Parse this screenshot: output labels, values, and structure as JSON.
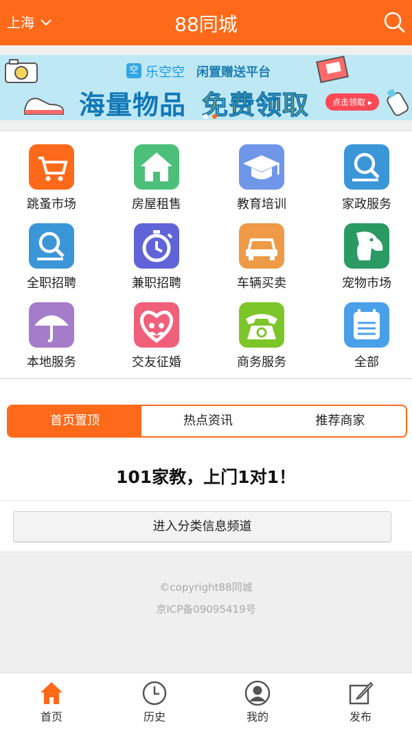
{
  "header": {
    "city": "上海",
    "title": "88同城",
    "bg_color": "#ff6a1a"
  },
  "banner": {
    "brand_icon_text": "空",
    "brand": "乐空空",
    "slogan": "闲置赠送平台",
    "headline_left": "海量物品",
    "headline_right": "免费领取",
    "cta": "点击领取 ▸",
    "active_dot": 2,
    "dot_count": 2
  },
  "categories": [
    {
      "label": "跳蚤市场",
      "icon": "cart-icon",
      "color": "#ff6a1a"
    },
    {
      "label": "房屋租售",
      "icon": "house-icon",
      "color": "#4cc07a"
    },
    {
      "label": "教育培训",
      "icon": "graduation-cap-icon",
      "color": "#6f96e8"
    },
    {
      "label": "家政服务",
      "icon": "magnifier-icon",
      "color": "#3b96d8"
    },
    {
      "label": "全职招聘",
      "icon": "magnifier-icon",
      "color": "#3b96d8"
    },
    {
      "label": "兼职招聘",
      "icon": "stopwatch-icon",
      "color": "#6064d8"
    },
    {
      "label": "车辆买卖",
      "icon": "car-icon",
      "color": "#ee9a47"
    },
    {
      "label": "宠物市场",
      "icon": "dog-icon",
      "color": "#2a9a62"
    },
    {
      "label": "本地服务",
      "icon": "umbrella-icon",
      "color": "#a57cc9"
    },
    {
      "label": "交友征婚",
      "icon": "heart-icon",
      "color": "#f0607a"
    },
    {
      "label": "商务服务",
      "icon": "telephone-icon",
      "color": "#7cc62a"
    },
    {
      "label": "全部",
      "icon": "calendar-list-icon",
      "color": "#4aa0e8"
    }
  ],
  "tabs": [
    {
      "label": "首页置顶",
      "active": true
    },
    {
      "label": "热点资讯",
      "active": false
    },
    {
      "label": "推荐商家",
      "active": false
    }
  ],
  "promo": "101家教，上门1对1！",
  "enter_button": "进入分类信息频道",
  "footer": {
    "copyright": "©copyright88同城",
    "icp": "京ICP备09095419号"
  },
  "nav": [
    {
      "label": "首页",
      "icon": "home-icon",
      "active": true
    },
    {
      "label": "历史",
      "icon": "clock-icon",
      "active": false
    },
    {
      "label": "我的",
      "icon": "user-icon",
      "active": false
    },
    {
      "label": "发布",
      "icon": "edit-icon",
      "active": false
    }
  ]
}
